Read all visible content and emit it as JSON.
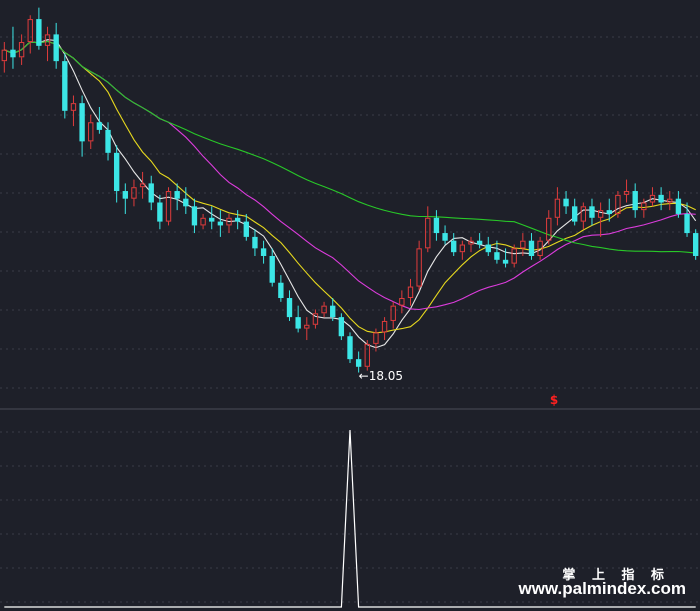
{
  "chart_data": [
    {
      "type": "candlestick",
      "panel": "price",
      "title": "",
      "xlabel": "",
      "ylabel": "",
      "ylim": [
        17.2,
        27.8
      ],
      "grid": true,
      "candles": [
        [
          26.2,
          26.7,
          25.9,
          26.5
        ],
        [
          26.5,
          27.1,
          26.0,
          26.3
        ],
        [
          26.3,
          26.9,
          26.1,
          26.7
        ],
        [
          26.7,
          27.4,
          26.4,
          27.3
        ],
        [
          27.3,
          27.6,
          26.5,
          26.6
        ],
        [
          26.6,
          27.1,
          26.2,
          26.9
        ],
        [
          26.9,
          27.2,
          26.0,
          26.2
        ],
        [
          26.2,
          26.4,
          24.7,
          24.9
        ],
        [
          24.9,
          25.3,
          24.5,
          25.1
        ],
        [
          25.1,
          25.3,
          23.7,
          24.1
        ],
        [
          24.1,
          24.8,
          23.9,
          24.6
        ],
        [
          24.6,
          25.0,
          24.3,
          24.4
        ],
        [
          24.4,
          24.6,
          23.6,
          23.8
        ],
        [
          23.8,
          24.0,
          22.5,
          22.8
        ],
        [
          22.8,
          23.0,
          22.2,
          22.6
        ],
        [
          22.6,
          23.1,
          22.4,
          22.9
        ],
        [
          22.9,
          23.3,
          22.6,
          23.0
        ],
        [
          23.0,
          23.2,
          22.3,
          22.5
        ],
        [
          22.5,
          22.7,
          21.8,
          22.0
        ],
        [
          22.0,
          22.9,
          21.9,
          22.8
        ],
        [
          22.8,
          23.0,
          22.3,
          22.6
        ],
        [
          22.6,
          22.9,
          22.2,
          22.4
        ],
        [
          22.4,
          22.6,
          21.7,
          21.9
        ],
        [
          21.9,
          22.2,
          21.8,
          22.1
        ],
        [
          22.1,
          22.4,
          21.8,
          22.0
        ],
        [
          22.0,
          22.3,
          21.6,
          21.9
        ],
        [
          21.9,
          22.2,
          21.7,
          22.1
        ],
        [
          22.1,
          22.3,
          21.8,
          22.0
        ],
        [
          22.0,
          22.2,
          21.5,
          21.6
        ],
        [
          21.6,
          21.8,
          21.1,
          21.3
        ],
        [
          21.3,
          21.5,
          20.9,
          21.1
        ],
        [
          21.1,
          21.3,
          20.3,
          20.4
        ],
        [
          20.4,
          20.6,
          19.9,
          20.0
        ],
        [
          20.0,
          20.2,
          19.4,
          19.5
        ],
        [
          19.5,
          19.8,
          19.1,
          19.2
        ],
        [
          19.2,
          19.5,
          18.9,
          19.3
        ],
        [
          19.3,
          19.7,
          19.2,
          19.6
        ],
        [
          19.6,
          19.9,
          19.5,
          19.8
        ],
        [
          19.8,
          20.0,
          19.4,
          19.5
        ],
        [
          19.5,
          19.6,
          18.9,
          19.0
        ],
        [
          19.0,
          19.1,
          18.3,
          18.4
        ],
        [
          18.4,
          18.6,
          18.05,
          18.2
        ],
        [
          18.2,
          18.9,
          18.1,
          18.8
        ],
        [
          18.8,
          19.2,
          18.6,
          19.1
        ],
        [
          19.1,
          19.5,
          18.9,
          19.4
        ],
        [
          19.4,
          19.9,
          19.2,
          19.8
        ],
        [
          19.8,
          20.2,
          19.6,
          20.0
        ],
        [
          20.0,
          20.5,
          19.8,
          20.3
        ],
        [
          20.3,
          21.5,
          20.2,
          21.3
        ],
        [
          21.3,
          22.4,
          21.2,
          22.1
        ],
        [
          22.1,
          22.3,
          21.5,
          21.7
        ],
        [
          21.7,
          21.9,
          21.4,
          21.5
        ],
        [
          21.5,
          21.7,
          21.1,
          21.2
        ],
        [
          21.2,
          21.5,
          21.0,
          21.4
        ],
        [
          21.4,
          21.6,
          21.2,
          21.5
        ],
        [
          21.5,
          21.7,
          21.3,
          21.4
        ],
        [
          21.4,
          21.6,
          21.1,
          21.2
        ],
        [
          21.2,
          21.5,
          20.9,
          21.0
        ],
        [
          21.0,
          21.3,
          20.8,
          20.9
        ],
        [
          20.9,
          21.4,
          20.8,
          21.3
        ],
        [
          21.3,
          21.7,
          21.1,
          21.5
        ],
        [
          21.5,
          21.7,
          21.0,
          21.1
        ],
        [
          21.1,
          21.6,
          21.0,
          21.5
        ],
        [
          21.5,
          22.3,
          21.4,
          22.1
        ],
        [
          22.1,
          22.9,
          21.9,
          22.6
        ],
        [
          22.6,
          22.8,
          22.2,
          22.4
        ],
        [
          22.4,
          22.6,
          21.9,
          22.0
        ],
        [
          22.0,
          22.5,
          21.8,
          22.4
        ],
        [
          22.4,
          22.6,
          21.9,
          22.1
        ],
        [
          22.1,
          22.5,
          21.6,
          22.3
        ],
        [
          22.3,
          22.6,
          22.0,
          22.2
        ],
        [
          22.2,
          22.8,
          22.1,
          22.7
        ],
        [
          22.7,
          23.1,
          22.5,
          22.8
        ],
        [
          22.8,
          23.0,
          22.1,
          22.3
        ],
        [
          22.3,
          22.6,
          22.1,
          22.5
        ],
        [
          22.5,
          22.9,
          22.4,
          22.7
        ],
        [
          22.7,
          22.9,
          22.3,
          22.5
        ],
        [
          22.5,
          22.8,
          22.3,
          22.6
        ],
        [
          22.6,
          22.8,
          22.1,
          22.2
        ],
        [
          22.2,
          22.5,
          21.6,
          21.7
        ],
        [
          21.7,
          21.8,
          21.0,
          21.1
        ]
      ],
      "ma_colors": [
        "#e6e6e6",
        "#e6d81e",
        "#dc3cdc",
        "#28c828"
      ],
      "up_color": "#e03c3c",
      "down_color": "#3ce6e6",
      "annotations": [
        {
          "text": "18.05",
          "arrow": "←"
        }
      ],
      "signal_text": "$",
      "signal_color": "#ff2020"
    },
    {
      "type": "line",
      "panel": "indicator",
      "title": "",
      "ylim": [
        0,
        1
      ],
      "line_color": "#ffffff",
      "values": [
        0,
        0,
        0,
        0,
        0,
        0,
        0,
        0,
        0,
        0,
        0,
        0,
        0,
        0,
        0,
        0,
        0,
        0,
        0,
        0,
        0,
        0,
        0,
        0,
        0,
        0,
        0,
        0,
        0,
        0,
        0,
        0,
        0,
        0,
        0,
        0,
        0,
        0,
        0,
        0,
        1,
        0,
        0,
        0,
        0,
        0,
        0,
        0,
        0,
        0,
        0,
        0,
        0,
        0,
        0,
        0,
        0,
        0,
        0,
        0,
        0,
        0,
        0,
        0,
        0,
        0,
        0,
        0,
        0,
        0,
        0,
        0,
        0,
        0,
        0,
        0,
        0,
        0,
        0,
        0,
        0
      ]
    }
  ],
  "watermark": {
    "brand": "掌 上 指 标",
    "url": "www.palmindex.com"
  }
}
